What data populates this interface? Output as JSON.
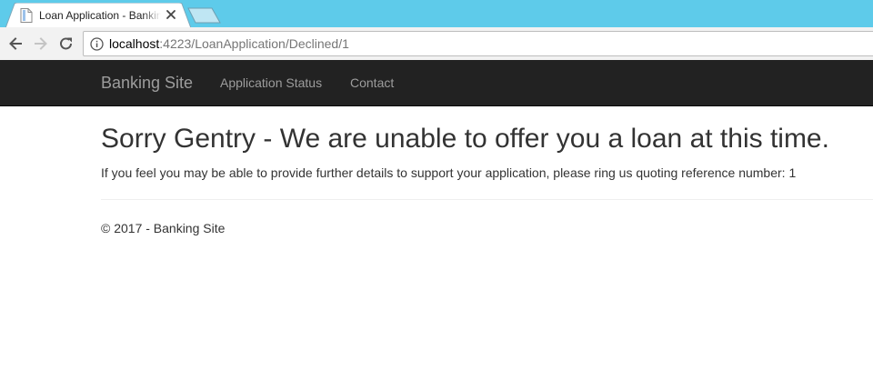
{
  "browser": {
    "tab": {
      "title": "Loan Application - Banking Site",
      "favicon": "document-icon",
      "close_icon": "close-icon"
    },
    "new_tab_icon": "new-tab-icon",
    "toolbar": {
      "back_icon": "arrow-left-icon",
      "forward_icon": "arrow-right-icon",
      "reload_icon": "reload-icon",
      "info_icon": "info-icon",
      "url_host": "localhost",
      "url_rest": ":4223/LoanApplication/Declined/1"
    },
    "colors": {
      "tabstrip": "#5ecbea",
      "toolbar": "#f2f2f2"
    }
  },
  "navbar": {
    "brand": "Banking Site",
    "links": [
      {
        "label": "Application Status"
      },
      {
        "label": "Contact"
      }
    ],
    "background": "#222222",
    "link_color": "#9d9d9d"
  },
  "main": {
    "heading": "Sorry Gentry - We are unable to offer you a loan at this time.",
    "message": "If you feel you may be able to provide further details to support your application, please ring us quoting reference number: 1"
  },
  "footer": {
    "text": "© 2017 - Banking Site"
  }
}
